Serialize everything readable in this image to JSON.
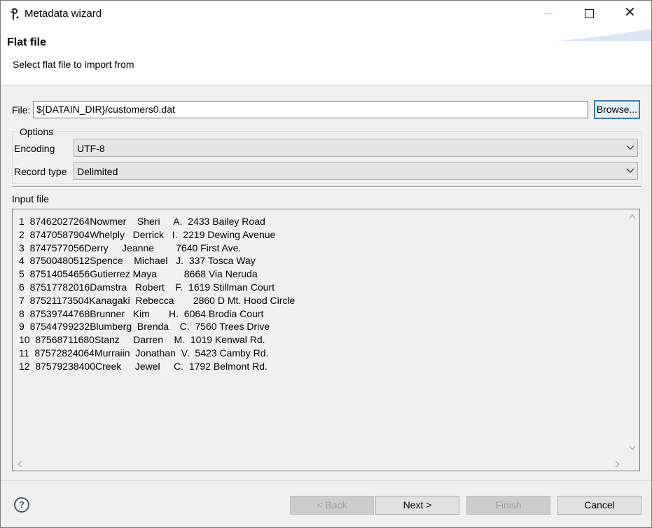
{
  "window": {
    "title": "Metadata wizard",
    "app_icon": "talend-icon"
  },
  "banner": {
    "title": "Flat file",
    "description": "Select flat file to import from"
  },
  "file": {
    "label": "File:",
    "value": "${DATAIN_DIR}/customers0.dat",
    "browse_label": "Browse..."
  },
  "options": {
    "legend": "Options",
    "encoding": {
      "label": "Encoding",
      "value": "UTF-8"
    },
    "record_type": {
      "label": "Record type",
      "value": "Delimited"
    }
  },
  "input_file": {
    "label": "Input file",
    "lines": [
      "1  87462027264Nowmer    Sheri     A.  2433 Bailey Road",
      "2  87470587904Whelply   Derrick   I.  2219 Dewing Avenue",
      "3  8747577056Derry     Jeanne        7640 First Ave.",
      "4  87500480512Spence    Michael   J.  337 Tosca Way",
      "5  87514054656Gutierrez Maya          8668 Via Neruda",
      "6  87517782016Damstra   Robert    F.  1619 Stillman Court",
      "7  87521173504Kanagaki  Rebecca       2860 D Mt. Hood Circle",
      "8  87539744768Brunner   Kim       H.  6064 Brodia Court",
      "9  87544799232Blumberg  Brenda    C.  7560 Trees Drive",
      "10  87568711680Stanz     Darren    M.  1019 Kenwal Rd.",
      "11  87572824064Murraiin  Jonathan  V.  5423 Camby Rd.",
      "12  87579238400Creek     Jewel     C.  1792 Belmont Rd."
    ]
  },
  "footer": {
    "back_label": "< Back",
    "next_label": "Next >",
    "finish_label": "Finish",
    "cancel_label": "Cancel",
    "help_glyph": "?"
  },
  "colors": {
    "focus_border": "#3c7fb1",
    "disabled_text": "#a0a0a0"
  }
}
